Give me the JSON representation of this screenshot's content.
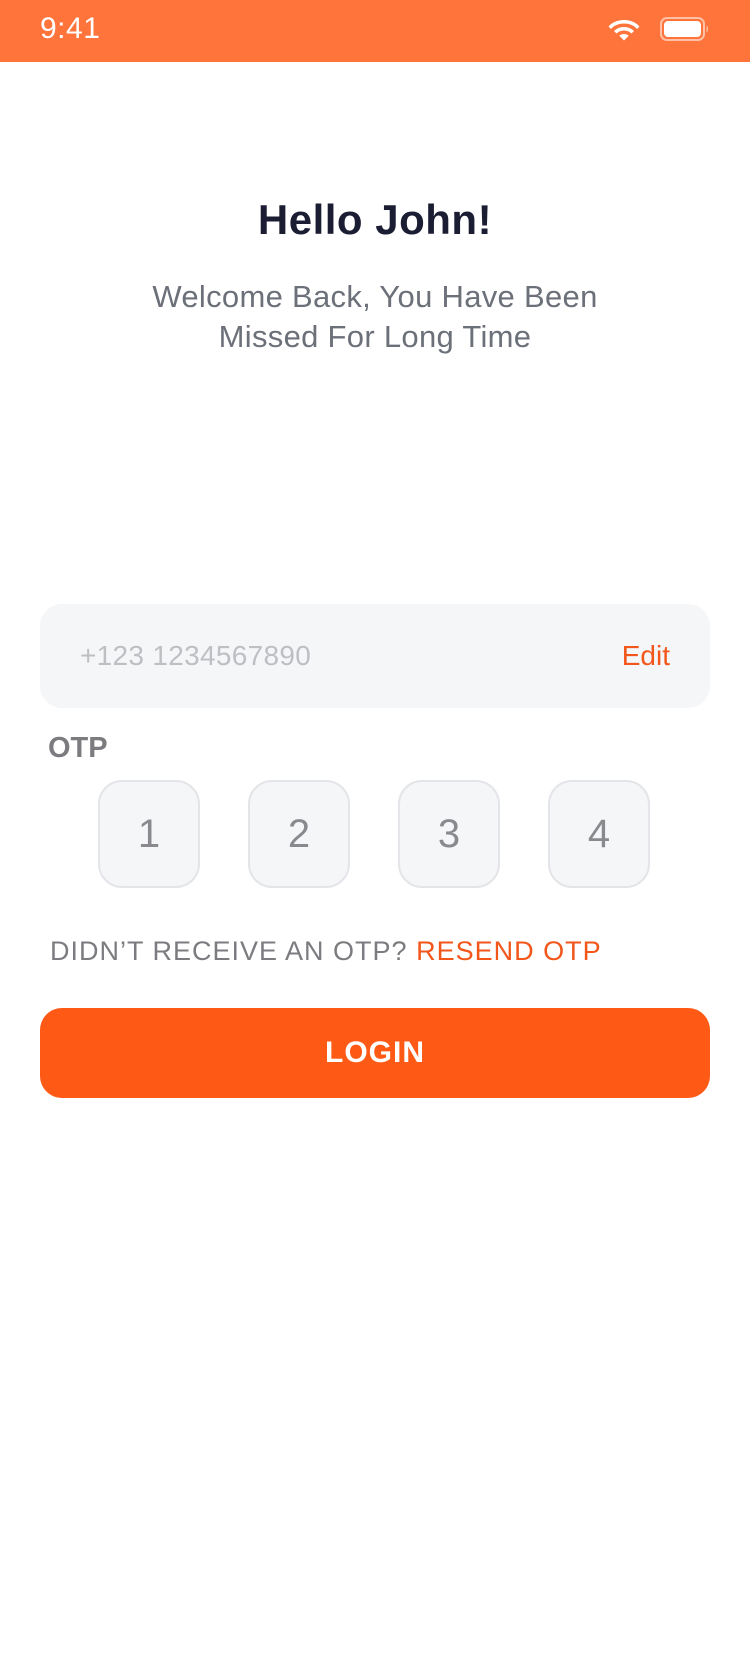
{
  "status_bar": {
    "time": "9:41",
    "background_color": "#FF743A",
    "icons": [
      "wifi-icon",
      "battery-icon"
    ]
  },
  "greeting": {
    "title": "Hello John!",
    "subtitle": "Welcome Back, You Have Been Missed For Long Time"
  },
  "phone": {
    "value": "+123 1234567890",
    "edit_label": "Edit"
  },
  "otp": {
    "label": "OTP",
    "digits": [
      "1",
      "2",
      "3",
      "4"
    ]
  },
  "resend": {
    "prompt": "DIDN’T RECEIVE AN OTP?",
    "link_label": "RESEND OTP"
  },
  "login": {
    "label": "LOGIN"
  },
  "colors": {
    "accent": "#FF5916",
    "link": "#F2561B",
    "title": "#1B1D33",
    "subtitle": "#6B7079",
    "field_background": "#F5F6F8"
  }
}
